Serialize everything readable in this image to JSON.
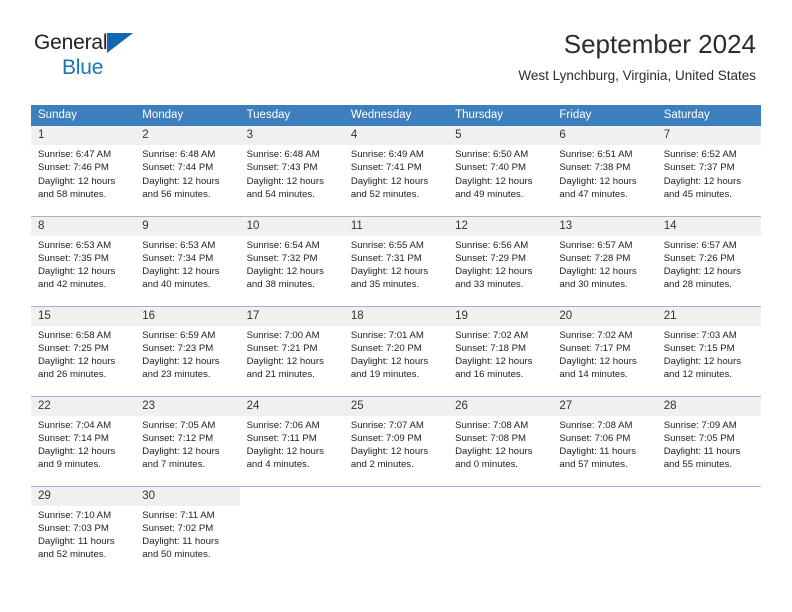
{
  "brand": {
    "line1": "General",
    "line2": "Blue",
    "triangle_icon": "triangle-icon",
    "accent_color": "#1b75bb"
  },
  "header": {
    "title": "September 2024",
    "location": "West Lynchburg, Virginia, United States"
  },
  "calendar": {
    "header_bg": "#3d7ebd",
    "daynum_bg": "#f0f0f0",
    "weekday_headers": [
      "Sunday",
      "Monday",
      "Tuesday",
      "Wednesday",
      "Thursday",
      "Friday",
      "Saturday"
    ],
    "weeks": [
      [
        {
          "day": "1",
          "sunrise": "Sunrise: 6:47 AM",
          "sunset": "Sunset: 7:46 PM",
          "daylight_line1": "Daylight: 12 hours",
          "daylight_line2": "and 58 minutes."
        },
        {
          "day": "2",
          "sunrise": "Sunrise: 6:48 AM",
          "sunset": "Sunset: 7:44 PM",
          "daylight_line1": "Daylight: 12 hours",
          "daylight_line2": "and 56 minutes."
        },
        {
          "day": "3",
          "sunrise": "Sunrise: 6:48 AM",
          "sunset": "Sunset: 7:43 PM",
          "daylight_line1": "Daylight: 12 hours",
          "daylight_line2": "and 54 minutes."
        },
        {
          "day": "4",
          "sunrise": "Sunrise: 6:49 AM",
          "sunset": "Sunset: 7:41 PM",
          "daylight_line1": "Daylight: 12 hours",
          "daylight_line2": "and 52 minutes."
        },
        {
          "day": "5",
          "sunrise": "Sunrise: 6:50 AM",
          "sunset": "Sunset: 7:40 PM",
          "daylight_line1": "Daylight: 12 hours",
          "daylight_line2": "and 49 minutes."
        },
        {
          "day": "6",
          "sunrise": "Sunrise: 6:51 AM",
          "sunset": "Sunset: 7:38 PM",
          "daylight_line1": "Daylight: 12 hours",
          "daylight_line2": "and 47 minutes."
        },
        {
          "day": "7",
          "sunrise": "Sunrise: 6:52 AM",
          "sunset": "Sunset: 7:37 PM",
          "daylight_line1": "Daylight: 12 hours",
          "daylight_line2": "and 45 minutes."
        }
      ],
      [
        {
          "day": "8",
          "sunrise": "Sunrise: 6:53 AM",
          "sunset": "Sunset: 7:35 PM",
          "daylight_line1": "Daylight: 12 hours",
          "daylight_line2": "and 42 minutes."
        },
        {
          "day": "9",
          "sunrise": "Sunrise: 6:53 AM",
          "sunset": "Sunset: 7:34 PM",
          "daylight_line1": "Daylight: 12 hours",
          "daylight_line2": "and 40 minutes."
        },
        {
          "day": "10",
          "sunrise": "Sunrise: 6:54 AM",
          "sunset": "Sunset: 7:32 PM",
          "daylight_line1": "Daylight: 12 hours",
          "daylight_line2": "and 38 minutes."
        },
        {
          "day": "11",
          "sunrise": "Sunrise: 6:55 AM",
          "sunset": "Sunset: 7:31 PM",
          "daylight_line1": "Daylight: 12 hours",
          "daylight_line2": "and 35 minutes."
        },
        {
          "day": "12",
          "sunrise": "Sunrise: 6:56 AM",
          "sunset": "Sunset: 7:29 PM",
          "daylight_line1": "Daylight: 12 hours",
          "daylight_line2": "and 33 minutes."
        },
        {
          "day": "13",
          "sunrise": "Sunrise: 6:57 AM",
          "sunset": "Sunset: 7:28 PM",
          "daylight_line1": "Daylight: 12 hours",
          "daylight_line2": "and 30 minutes."
        },
        {
          "day": "14",
          "sunrise": "Sunrise: 6:57 AM",
          "sunset": "Sunset: 7:26 PM",
          "daylight_line1": "Daylight: 12 hours",
          "daylight_line2": "and 28 minutes."
        }
      ],
      [
        {
          "day": "15",
          "sunrise": "Sunrise: 6:58 AM",
          "sunset": "Sunset: 7:25 PM",
          "daylight_line1": "Daylight: 12 hours",
          "daylight_line2": "and 26 minutes."
        },
        {
          "day": "16",
          "sunrise": "Sunrise: 6:59 AM",
          "sunset": "Sunset: 7:23 PM",
          "daylight_line1": "Daylight: 12 hours",
          "daylight_line2": "and 23 minutes."
        },
        {
          "day": "17",
          "sunrise": "Sunrise: 7:00 AM",
          "sunset": "Sunset: 7:21 PM",
          "daylight_line1": "Daylight: 12 hours",
          "daylight_line2": "and 21 minutes."
        },
        {
          "day": "18",
          "sunrise": "Sunrise: 7:01 AM",
          "sunset": "Sunset: 7:20 PM",
          "daylight_line1": "Daylight: 12 hours",
          "daylight_line2": "and 19 minutes."
        },
        {
          "day": "19",
          "sunrise": "Sunrise: 7:02 AM",
          "sunset": "Sunset: 7:18 PM",
          "daylight_line1": "Daylight: 12 hours",
          "daylight_line2": "and 16 minutes."
        },
        {
          "day": "20",
          "sunrise": "Sunrise: 7:02 AM",
          "sunset": "Sunset: 7:17 PM",
          "daylight_line1": "Daylight: 12 hours",
          "daylight_line2": "and 14 minutes."
        },
        {
          "day": "21",
          "sunrise": "Sunrise: 7:03 AM",
          "sunset": "Sunset: 7:15 PM",
          "daylight_line1": "Daylight: 12 hours",
          "daylight_line2": "and 12 minutes."
        }
      ],
      [
        {
          "day": "22",
          "sunrise": "Sunrise: 7:04 AM",
          "sunset": "Sunset: 7:14 PM",
          "daylight_line1": "Daylight: 12 hours",
          "daylight_line2": "and 9 minutes."
        },
        {
          "day": "23",
          "sunrise": "Sunrise: 7:05 AM",
          "sunset": "Sunset: 7:12 PM",
          "daylight_line1": "Daylight: 12 hours",
          "daylight_line2": "and 7 minutes."
        },
        {
          "day": "24",
          "sunrise": "Sunrise: 7:06 AM",
          "sunset": "Sunset: 7:11 PM",
          "daylight_line1": "Daylight: 12 hours",
          "daylight_line2": "and 4 minutes."
        },
        {
          "day": "25",
          "sunrise": "Sunrise: 7:07 AM",
          "sunset": "Sunset: 7:09 PM",
          "daylight_line1": "Daylight: 12 hours",
          "daylight_line2": "and 2 minutes."
        },
        {
          "day": "26",
          "sunrise": "Sunrise: 7:08 AM",
          "sunset": "Sunset: 7:08 PM",
          "daylight_line1": "Daylight: 12 hours",
          "daylight_line2": "and 0 minutes."
        },
        {
          "day": "27",
          "sunrise": "Sunrise: 7:08 AM",
          "sunset": "Sunset: 7:06 PM",
          "daylight_line1": "Daylight: 11 hours",
          "daylight_line2": "and 57 minutes."
        },
        {
          "day": "28",
          "sunrise": "Sunrise: 7:09 AM",
          "sunset": "Sunset: 7:05 PM",
          "daylight_line1": "Daylight: 11 hours",
          "daylight_line2": "and 55 minutes."
        }
      ],
      [
        {
          "day": "29",
          "sunrise": "Sunrise: 7:10 AM",
          "sunset": "Sunset: 7:03 PM",
          "daylight_line1": "Daylight: 11 hours",
          "daylight_line2": "and 52 minutes."
        },
        {
          "day": "30",
          "sunrise": "Sunrise: 7:11 AM",
          "sunset": "Sunset: 7:02 PM",
          "daylight_line1": "Daylight: 11 hours",
          "daylight_line2": "and 50 minutes."
        },
        {
          "day": "",
          "sunrise": "",
          "sunset": "",
          "daylight_line1": "",
          "daylight_line2": ""
        },
        {
          "day": "",
          "sunrise": "",
          "sunset": "",
          "daylight_line1": "",
          "daylight_line2": ""
        },
        {
          "day": "",
          "sunrise": "",
          "sunset": "",
          "daylight_line1": "",
          "daylight_line2": ""
        },
        {
          "day": "",
          "sunrise": "",
          "sunset": "",
          "daylight_line1": "",
          "daylight_line2": ""
        },
        {
          "day": "",
          "sunrise": "",
          "sunset": "",
          "daylight_line1": "",
          "daylight_line2": ""
        }
      ]
    ]
  }
}
